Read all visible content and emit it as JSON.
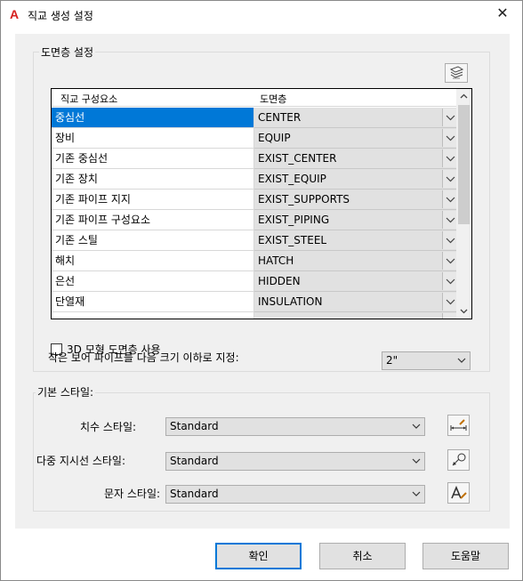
{
  "window": {
    "title": "직교 생성 설정",
    "close_symbol": "✕",
    "app_icon_letter": "A"
  },
  "layer_group": {
    "label": "도면층 설정",
    "header": {
      "col1": "직교 구성요소",
      "col2": "도면층"
    },
    "rows": [
      {
        "name": "중심선",
        "layer": "CENTER",
        "selected": true
      },
      {
        "name": "장비",
        "layer": "EQUIP"
      },
      {
        "name": "기존 중심선",
        "layer": "EXIST_CENTER"
      },
      {
        "name": "기존 장치",
        "layer": "EXIST_EQUIP"
      },
      {
        "name": "기존 파이프 지지",
        "layer": "EXIST_SUPPORTS"
      },
      {
        "name": "기존 파이프 구성요소",
        "layer": "EXIST_PIPING"
      },
      {
        "name": "기존 스틸",
        "layer": "EXIST_STEEL"
      },
      {
        "name": "해치",
        "layer": "HATCH"
      },
      {
        "name": "은선",
        "layer": "HIDDEN"
      },
      {
        "name": "단열재",
        "layer": "INSULATION"
      },
      {
        "name": "",
        "layer": ""
      }
    ],
    "use_3d_checkbox": {
      "label": "3D 모형 도면층 사용",
      "checked": false
    },
    "small_bore_label": "작은 보어 파이프를 다음 크기 이하로 지정:",
    "small_bore_value": "2\""
  },
  "style_group": {
    "label": "기본 스타일:",
    "dim_style": {
      "label": "치수 스타일:",
      "value": "Standard"
    },
    "mleader_style": {
      "label": "다중 지시선 스타일:",
      "value": "Standard"
    },
    "text_style": {
      "label": "문자 스타일:",
      "value": "Standard"
    }
  },
  "buttons": {
    "ok": "확인",
    "cancel": "취소",
    "help": "도움말"
  },
  "colors": {
    "selection": "#0078d7",
    "accent_red": "#d6201f"
  }
}
